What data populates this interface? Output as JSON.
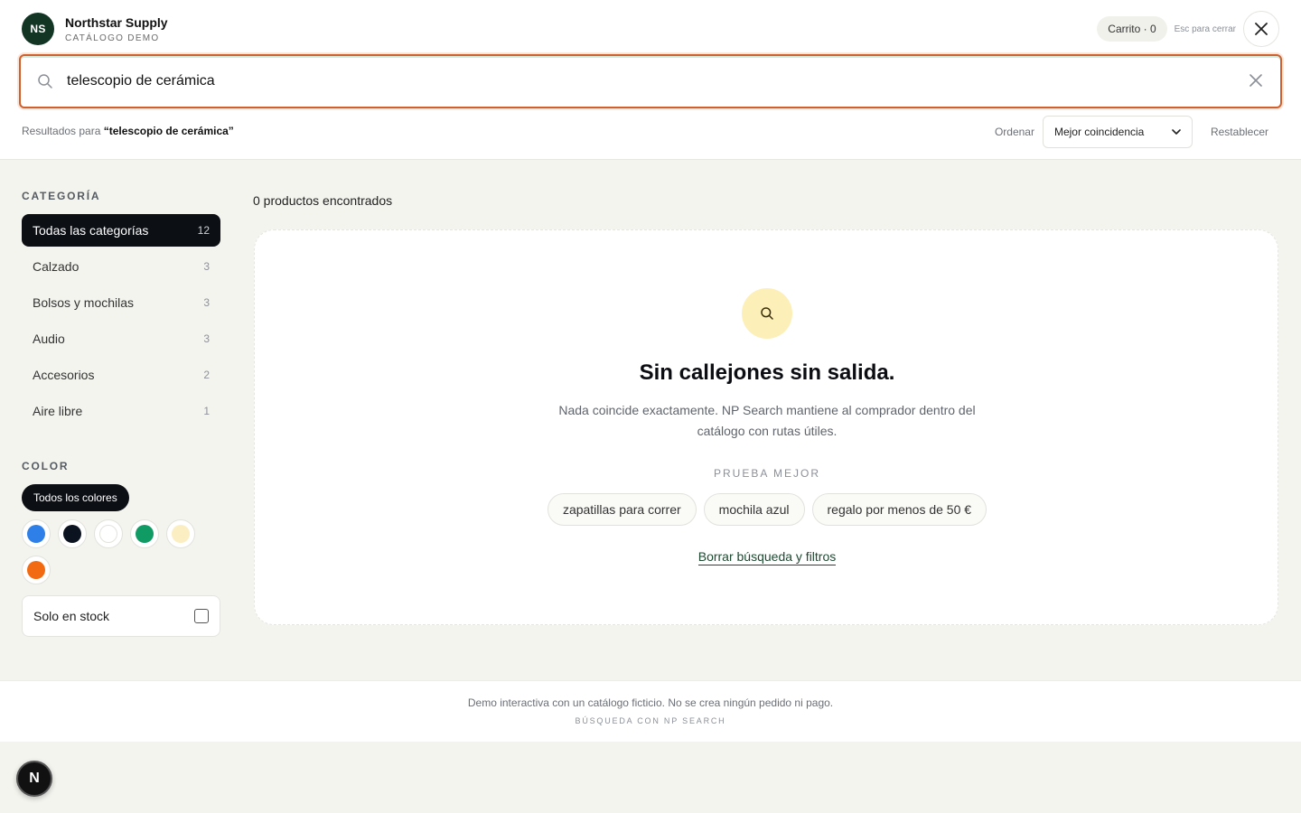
{
  "brand": {
    "initials": "NS",
    "name": "Northstar Supply",
    "subtitle": "CATÁLOGO DEMO"
  },
  "header": {
    "cart_label": "Carrito · 0",
    "esc_hint": "Esc para cerrar",
    "close_icon": "close-icon"
  },
  "search": {
    "value": "telescopio de cerámica",
    "placeholder": "",
    "icon": "search-icon",
    "clear_icon": "clear-icon"
  },
  "results": {
    "prefix": "Resultados para",
    "query_quoted": "“telescopio de cerámica”"
  },
  "sort": {
    "label": "Ordenar",
    "selected": "Mejor coincidencia",
    "reset_label": "Restablecer"
  },
  "sidebar": {
    "category_heading": "CATEGORÍA",
    "categories": [
      {
        "label": "Todas las categorías",
        "count": "12",
        "active": true
      },
      {
        "label": "Calzado",
        "count": "3"
      },
      {
        "label": "Bolsos y mochilas",
        "count": "3"
      },
      {
        "label": "Audio",
        "count": "3"
      },
      {
        "label": "Accesorios",
        "count": "2"
      },
      {
        "label": "Aire libre",
        "count": "1"
      }
    ],
    "color_heading": "COLOR",
    "all_colors_label": "Todos los colores",
    "swatch_colors": [
      "#2f7fe8",
      "#0b1220",
      "#ffffff",
      "#0f9b63",
      "#fbeec3",
      "#f26a12"
    ],
    "stock_label": "Solo en stock"
  },
  "main": {
    "found_label": "0 productos encontrados",
    "empty_title": "Sin callejones sin salida.",
    "empty_desc_line1": "Nada coincide exactamente. NP Search mantiene al comprador dentro del",
    "empty_desc_line2": "catálogo con rutas útiles.",
    "try_label": "PRUEBA MEJOR",
    "suggestions": [
      "zapatillas para correr",
      "mochila azul",
      "regalo por menos de 50 €"
    ],
    "clear_link": "Borrar búsqueda y filtros"
  },
  "footer": {
    "line1": "Demo interactiva con un catálogo ficticio. No se crea ningún pedido ni pago.",
    "line2": "BÚSQUEDA CON NP SEARCH"
  },
  "badge": {
    "letter": "N"
  },
  "colors": {
    "accent_border": "#d0602e",
    "brand_dark": "#123524",
    "link_green": "#1e4a31",
    "icon_bg": "#fcefb8"
  }
}
